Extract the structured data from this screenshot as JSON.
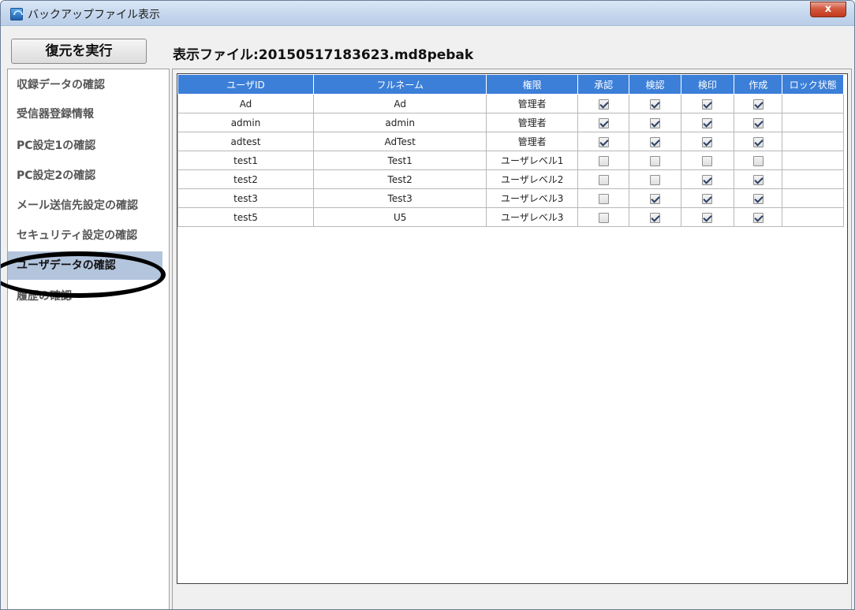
{
  "window": {
    "title": "バックアップファイル表示",
    "close_glyph": "x"
  },
  "toolbar": {
    "restore_label": "復元を実行",
    "file_label": "表示ファイル:20150517183623.md8pebak"
  },
  "sidebar": {
    "selected_index": 6,
    "items": [
      {
        "label": "収録データの確認"
      },
      {
        "label": "受信器登録情報"
      },
      {
        "label": "PC設定1の確認"
      },
      {
        "label": "PC設定2の確認"
      },
      {
        "label": "メール送信先設定の確認"
      },
      {
        "label": "セキュリティ設定の確認"
      },
      {
        "label": "ユーザデータの確認"
      },
      {
        "label": "履歴の確認"
      }
    ]
  },
  "table": {
    "columns": [
      "ユーザID",
      "フルネーム",
      "権限",
      "承認",
      "検認",
      "検印",
      "作成",
      "ロック状態"
    ],
    "rows": [
      {
        "user_id": "Ad",
        "full_name": "Ad",
        "role": "管理者",
        "approve": true,
        "verify": true,
        "seal": true,
        "create": true,
        "lock": ""
      },
      {
        "user_id": "admin",
        "full_name": "admin",
        "role": "管理者",
        "approve": true,
        "verify": true,
        "seal": true,
        "create": true,
        "lock": ""
      },
      {
        "user_id": "adtest",
        "full_name": "AdTest",
        "role": "管理者",
        "approve": true,
        "verify": true,
        "seal": true,
        "create": true,
        "lock": ""
      },
      {
        "user_id": "test1",
        "full_name": "Test1",
        "role": "ユーザレベル1",
        "approve": false,
        "verify": false,
        "seal": false,
        "create": false,
        "lock": ""
      },
      {
        "user_id": "test2",
        "full_name": "Test2",
        "role": "ユーザレベル2",
        "approve": false,
        "verify": false,
        "seal": true,
        "create": true,
        "lock": ""
      },
      {
        "user_id": "test3",
        "full_name": "Test3",
        "role": "ユーザレベル3",
        "approve": false,
        "verify": true,
        "seal": true,
        "create": true,
        "lock": ""
      },
      {
        "user_id": "test5",
        "full_name": "U5",
        "role": "ユーザレベル3",
        "approve": false,
        "verify": true,
        "seal": true,
        "create": true,
        "lock": ""
      }
    ]
  },
  "colors": {
    "header_bg": "#3c7fd8",
    "selected_bg": "#b3c4dd",
    "close_button": "#c23a1e"
  }
}
